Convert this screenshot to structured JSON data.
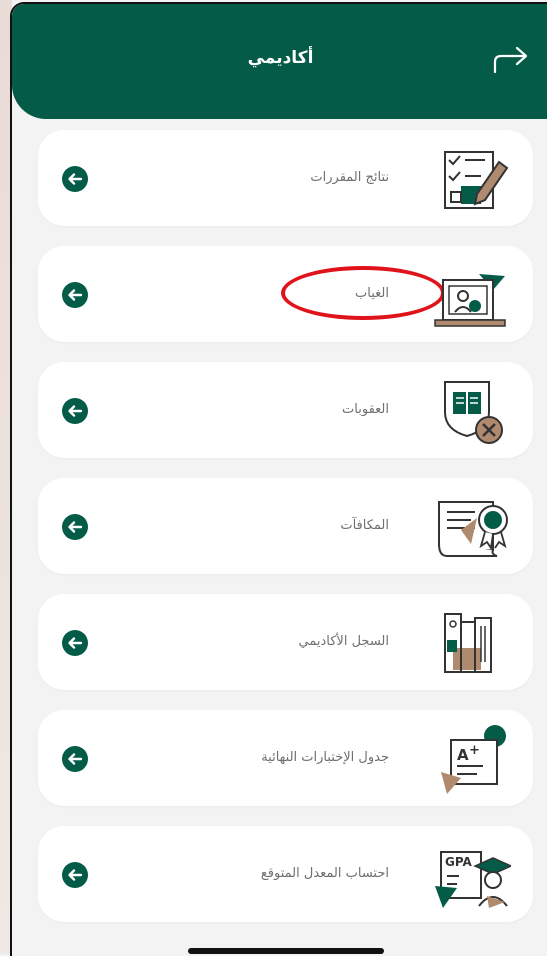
{
  "header": {
    "title": "أكاديمي"
  },
  "menu": {
    "items": [
      {
        "label": "نتائج المقررات",
        "icon": "test-results-icon"
      },
      {
        "label": "الغياب",
        "icon": "absence-icon"
      },
      {
        "label": "العقوبات",
        "icon": "penalties-icon"
      },
      {
        "label": "المكافآت",
        "icon": "rewards-icon"
      },
      {
        "label": "السجل الأكاديمي",
        "icon": "academic-record-icon"
      },
      {
        "label": "جدول الإختبارات النهائية",
        "icon": "final-exams-schedule-icon"
      },
      {
        "label": "احتساب المعدل المتوقع",
        "icon": "gpa-calculator-icon"
      }
    ]
  },
  "icons": {
    "text_1": "A",
    "text_2": "+",
    "text_3": "GPA"
  },
  "colors": {
    "primary": "#045c48",
    "accent_brown": "#b08a6e",
    "annotation_red": "#e0121a"
  }
}
